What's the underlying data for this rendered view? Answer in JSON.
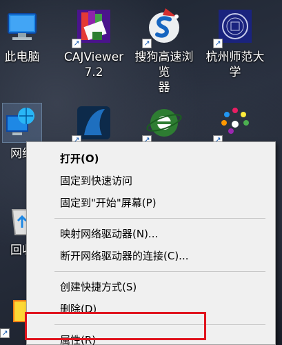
{
  "desktop": {
    "icons": [
      {
        "label": "此电脑"
      },
      {
        "label": "CAJViewer\n7.2"
      },
      {
        "label": "搜狗高速浏览\n器"
      },
      {
        "label": "杭州师范大学"
      },
      {
        "label": "网络"
      },
      {
        "label": "回收"
      }
    ]
  },
  "context_menu": {
    "items": {
      "open": "打开(O)",
      "pin_quick_access": "固定到快速访问",
      "pin_start": "固定到\"开始\"屏幕(P)",
      "map_drive": "映射网络驱动器(N)...",
      "disconnect_drive": "断开网络驱动器的连接(C)...",
      "create_shortcut": "创建快捷方式(S)",
      "delete": "删除(D)",
      "properties": "属性(R)"
    }
  },
  "colors": {
    "highlight": "#e0141e",
    "menu_bg": "#f0f0f0"
  }
}
